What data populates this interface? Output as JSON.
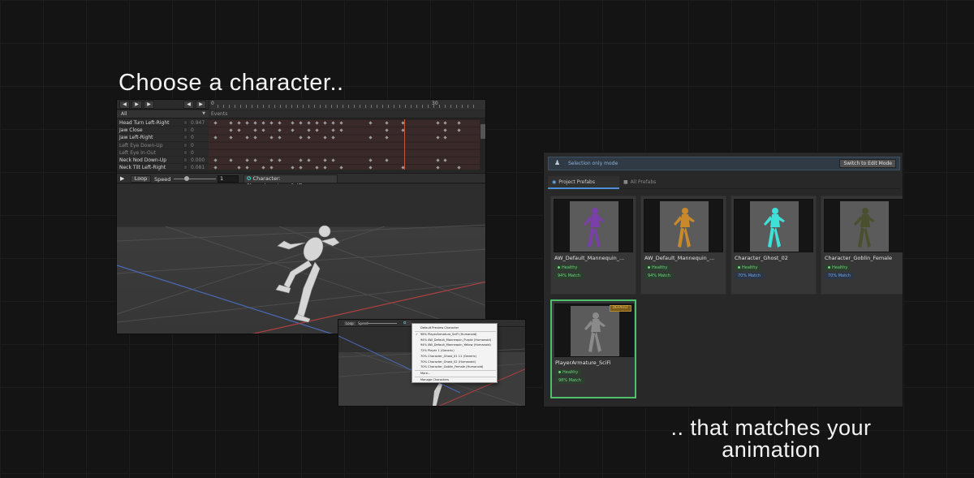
{
  "captions": {
    "top": "Choose a character..",
    "bottom_line1": ".. that matches your",
    "bottom_line2": "animation"
  },
  "anim_editor": {
    "toolbar_buttons": [
      "prev-frame",
      "play",
      "next-frame",
      "first-keyframe",
      "last-keyframe"
    ],
    "ruler_start": "0",
    "ruler_mark": "30",
    "filter": "All",
    "events_label": "Events",
    "properties": [
      {
        "name": "Head Turn Left-Right",
        "value": "0.947",
        "dim": false
      },
      {
        "name": "Jaw Close",
        "value": "0",
        "dim": false
      },
      {
        "name": "Jaw Left-Right",
        "value": "0",
        "dim": false
      },
      {
        "name": "Left Eye Down-Up",
        "value": "0",
        "dim": true
      },
      {
        "name": "Left Eye In-Out",
        "value": "0",
        "dim": true
      },
      {
        "name": "Neck Nod Down-Up",
        "value": "0.000",
        "dim": false
      },
      {
        "name": "Neck Tilt Left-Right",
        "value": "0.081",
        "dim": false
      }
    ],
    "preview_bar": {
      "loop_label": "Loop",
      "speed_label": "Speed",
      "speed_value": "1",
      "speed_fraction": 0.3,
      "character_label": "Character: PlayerArmature_SciFi"
    }
  },
  "mini_window": {
    "loop_label": "Loop",
    "speed_label": "Speed",
    "dropdown": {
      "header": "Default Preview Character",
      "items": [
        {
          "label": "98%  PlayerArmature_SciFi    (Humanoid)",
          "checked": true
        },
        {
          "label": "94%  AW_Default_Mannequin_Purple  (Humanoid)",
          "checked": false
        },
        {
          "label": "94%  AW_Default_Mannequin_Yellow  (Humanoid)",
          "checked": false
        },
        {
          "label": "72%  Player 1    (Generic)",
          "checked": false
        },
        {
          "label": "70%  Character_Ghost_01 11   (Generic)",
          "checked": false
        },
        {
          "label": "70%  Character_Ghost_02    (Humanoid)",
          "checked": false
        },
        {
          "label": "70%  Character_Goblin_Female    (Humanoid)",
          "checked": false
        }
      ],
      "more_label": "More...",
      "manage_label": "Manage Characters"
    }
  },
  "prefab_browser": {
    "mode_label": "Selection only mode",
    "switch_button": "Switch to Edit Mode",
    "tabs": [
      {
        "label": "Project Prefabs",
        "active": true
      },
      {
        "label": "All Prefabs",
        "active": false
      }
    ],
    "cards": [
      {
        "name": "AW_Default_Mannequin_...",
        "status": "Healthy",
        "match": "94% Match",
        "match_color": "green",
        "figure_color": "#7a3fa8",
        "is_default": false,
        "selected": false
      },
      {
        "name": "AW_Default_Mannequin_...",
        "status": "Healthy",
        "match": "94% Match",
        "match_color": "green",
        "figure_color": "#c8892a",
        "is_default": false,
        "selected": false
      },
      {
        "name": "Character_Ghost_02",
        "status": "Healthy",
        "match": "70% Match",
        "match_color": "blue",
        "figure_color": "#3fe0d8",
        "is_default": false,
        "selected": false
      },
      {
        "name": "Character_Goblin_Female",
        "status": "Healthy",
        "match": "70% Match",
        "match_color": "blue",
        "figure_color": "#4a4f2e",
        "is_default": false,
        "selected": false
      },
      {
        "name": "PlayerArmature_SciFi",
        "status": "Healthy",
        "match": "98% Match",
        "match_color": "green",
        "figure_color": "#8a8a8a",
        "is_default": true,
        "default_label": "DEFAULT",
        "selected": true
      }
    ]
  }
}
